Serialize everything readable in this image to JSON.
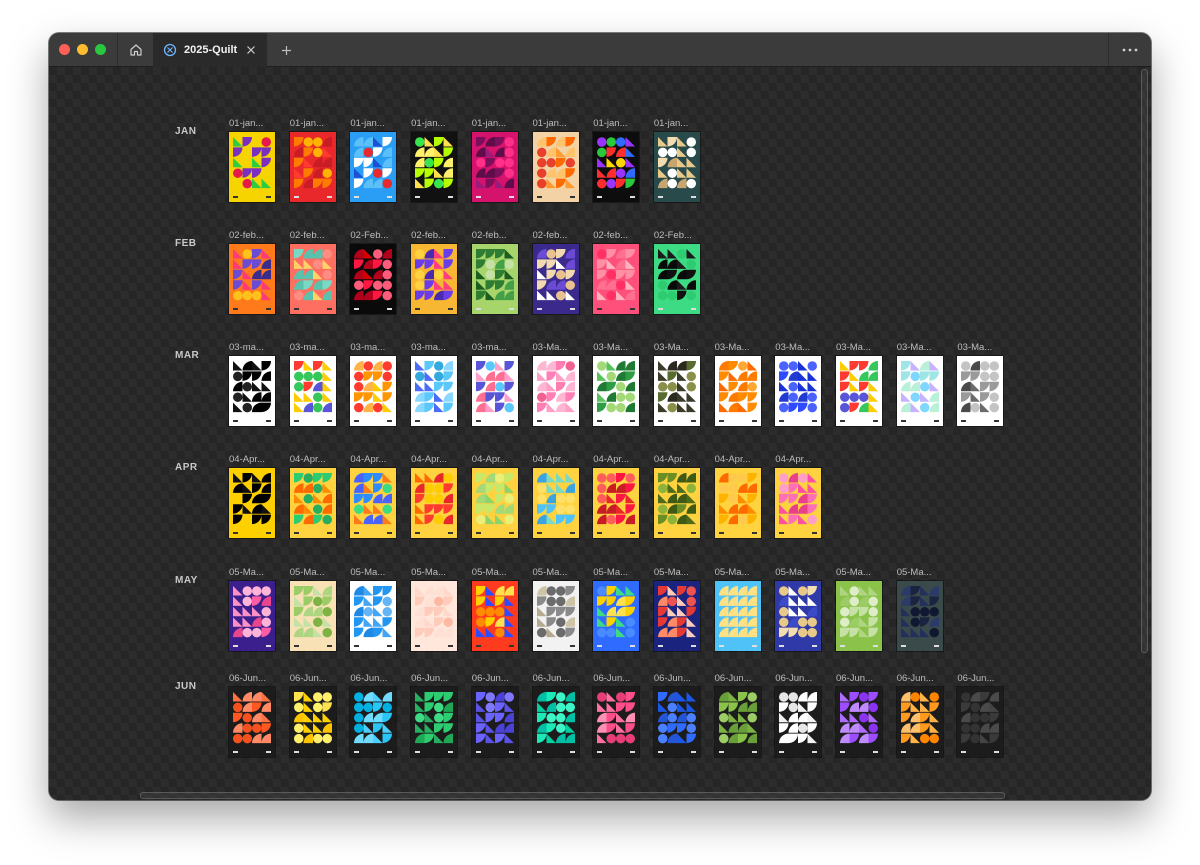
{
  "window": {
    "tab_title": "2025-Quilt",
    "icons": {
      "home": "home-icon",
      "tab": "figma-file-icon",
      "close": "close-icon",
      "new_tab": "plus-icon",
      "more": "more-horizontal-icon"
    }
  },
  "months": [
    {
      "label": "JAN",
      "thumbnails": [
        {
          "label": "01-jan...",
          "bg": "#f5d400",
          "colors": [
            "#7b2fbe",
            "#2ecc40",
            "#e6194b",
            "#f5d400"
          ]
        },
        {
          "label": "01-jan...",
          "bg": "#e8282a",
          "colors": [
            "#ff7b00",
            "#ff3b30",
            "#ffb300",
            "#c81d25"
          ]
        },
        {
          "label": "01-jan...",
          "bg": "#2a9df4",
          "colors": [
            "#ffffff",
            "#1a4fd6",
            "#e8282a",
            "#5bc0f8"
          ]
        },
        {
          "label": "01-jan...",
          "bg": "#111111",
          "colors": [
            "#b6ff00",
            "#ffe14d",
            "#38e54d",
            "#fff06a"
          ]
        },
        {
          "label": "01-jan...",
          "bg": "#d6136c",
          "colors": [
            "#7a0f5c",
            "#9b1b7a",
            "#ff2f8a",
            "#5e0c4a"
          ]
        },
        {
          "label": "01-jan...",
          "bg": "#f3d2a6",
          "colors": [
            "#ff6a00",
            "#ff9a2e",
            "#e8402a",
            "#ffc46b"
          ]
        },
        {
          "label": "01-jan...",
          "bg": "#0d0d0d",
          "colors": [
            "#ff2d2d",
            "#ffd600",
            "#29c93b",
            "#2f6bff",
            "#9b33ff"
          ]
        },
        {
          "label": "01-jan...",
          "bg": "#284a4a",
          "colors": [
            "#f3ddb0",
            "#e9c98a",
            "#ffffff",
            "#c7a56f"
          ]
        }
      ]
    },
    {
      "label": "FEB",
      "thumbnails": [
        {
          "label": "02-feb...",
          "bg": "#ff7a1a",
          "colors": [
            "#6b4bd6",
            "#ff3b77",
            "#ffc21a",
            "#3b2b8c"
          ]
        },
        {
          "label": "02-feb...",
          "bg": "#ff6f61",
          "colors": [
            "#7ad9c4",
            "#ffd166",
            "#ff8c82",
            "#59c2ad"
          ]
        },
        {
          "label": "02-Feb...",
          "bg": "#0a0a0a",
          "colors": [
            "#ff1744",
            "#d50000",
            "#ff5c7c",
            "#b3001b"
          ]
        },
        {
          "label": "02-feb...",
          "bg": "#f7b733",
          "colors": [
            "#6a3de8",
            "#ff3d7f",
            "#ffd23f",
            "#4a2bb0"
          ]
        },
        {
          "label": "02-feb...",
          "bg": "#a8d56b",
          "colors": [
            "#2e7d32",
            "#1b5e20",
            "#c5e1a5",
            "#43a047"
          ]
        },
        {
          "label": "02-feb...",
          "bg": "#3b2a8c",
          "colors": [
            "#f3d9b0",
            "#ffffff",
            "#e7c28e",
            "#6b4bd6"
          ]
        },
        {
          "label": "02-feb...",
          "bg": "#ff4f7b",
          "colors": [
            "#ff8fa3",
            "#ffb3c1",
            "#ff2e63",
            "#ff6f8f"
          ]
        },
        {
          "label": "02-Feb...",
          "bg": "#3ddc84",
          "colors": [
            "#111111",
            "#1b1b1b",
            "#2ecc71",
            "#0a0a0a"
          ]
        }
      ]
    },
    {
      "label": "MAR",
      "thumbnails": [
        {
          "label": "03-ma...",
          "bg": "#ffffff",
          "colors": [
            "#000000",
            "#111111",
            "#222222",
            "#000000"
          ]
        },
        {
          "label": "03-ma...",
          "bg": "#ffffff",
          "colors": [
            "#ff3b30",
            "#ffcc00",
            "#34c759",
            "#5856d6"
          ]
        },
        {
          "label": "03-ma...",
          "bg": "#ffffff",
          "colors": [
            "#ff9500",
            "#ffcc00",
            "#ff3b30",
            "#ffb347"
          ]
        },
        {
          "label": "03-ma...",
          "bg": "#ffffff",
          "colors": [
            "#5ac8fa",
            "#4a6cf7",
            "#34aadc",
            "#8ad8ff"
          ]
        },
        {
          "label": "03-ma...",
          "bg": "#ffffff",
          "colors": [
            "#5856d6",
            "#ff9ecb",
            "#5ac8fa",
            "#ff6f91"
          ]
        },
        {
          "label": "03-Ma...",
          "bg": "#ffffff",
          "colors": [
            "#ff7eb3",
            "#ff9fc5",
            "#f06292",
            "#ffb6d2"
          ]
        },
        {
          "label": "03-Ma...",
          "bg": "#ffffff",
          "colors": [
            "#2e9e44",
            "#58c35a",
            "#a3d977",
            "#1f7a33"
          ]
        },
        {
          "label": "03-Ma...",
          "bg": "#ffffff",
          "colors": [
            "#5a6b2f",
            "#3b3b2b",
            "#8a8f4a",
            "#2a2a1f"
          ]
        },
        {
          "label": "03-Ma...",
          "bg": "#ffffff",
          "colors": [
            "#ff8c00",
            "#ff6a00",
            "#ffa733",
            "#ff7b00"
          ]
        },
        {
          "label": "03-Ma...",
          "bg": "#ffffff",
          "colors": [
            "#2f4bff",
            "#1a33d6",
            "#4a63ff",
            "#213bd0"
          ]
        },
        {
          "label": "03-Ma...",
          "bg": "#ffffff",
          "colors": [
            "#ff3b30",
            "#ffcc00",
            "#5856d6",
            "#34c759"
          ]
        },
        {
          "label": "03-Ma...",
          "bg": "#ffffff",
          "colors": [
            "#9ee6e6",
            "#c6b3ff",
            "#7fd6ff",
            "#b8f0d8"
          ]
        },
        {
          "label": "03-Ma...",
          "bg": "#ffffff",
          "colors": [
            "#9a9a9a",
            "#6b6b6b",
            "#c4c4c4",
            "#4a4a4a"
          ]
        }
      ]
    },
    {
      "label": "APR",
      "thumbnails": [
        {
          "label": "04-Apr...",
          "bg": "#ffd000",
          "colors": [
            "#000000",
            "#111111",
            "#ffd000",
            "#000000"
          ]
        },
        {
          "label": "04-Apr...",
          "bg": "#ffd23f",
          "colors": [
            "#2ecc71",
            "#ff8c00",
            "#27ae60",
            "#ff6a00"
          ]
        },
        {
          "label": "04-Apr...",
          "bg": "#ffd23f",
          "colors": [
            "#2f8cff",
            "#ff7a1a",
            "#3ddc84",
            "#4a63ff"
          ]
        },
        {
          "label": "04-Apr...",
          "bg": "#ffd23f",
          "colors": [
            "#ff3b30",
            "#ff6a00",
            "#ffcc00",
            "#e8282a"
          ]
        },
        {
          "label": "04-Apr...",
          "bg": "#ffd23f",
          "colors": [
            "#c6e86b",
            "#8bd36b",
            "#e8f07a",
            "#a3d977"
          ]
        },
        {
          "label": "04-Apr...",
          "bg": "#ffd23f",
          "colors": [
            "#4fc3f7",
            "#7ad9c4",
            "#ffe066",
            "#3ba3e0"
          ]
        },
        {
          "label": "04-Apr...",
          "bg": "#ffd23f",
          "colors": [
            "#ff1744",
            "#e8282a",
            "#ff5c5c",
            "#c81d25"
          ]
        },
        {
          "label": "04-Apr...",
          "bg": "#ffd23f",
          "colors": [
            "#6b8e23",
            "#4e6b1a",
            "#8db33a",
            "#3f5a14"
          ]
        },
        {
          "label": "04-Apr...",
          "bg": "#ffd23f",
          "colors": [
            "#ffb300",
            "#ff8c00",
            "#ffc94d",
            "#ff6a00"
          ]
        },
        {
          "label": "04-Apr...",
          "bg": "#ffd23f",
          "colors": [
            "#ff6fb5",
            "#ff4fa0",
            "#ff9ecb",
            "#e83e8c"
          ]
        }
      ]
    },
    {
      "label": "MAY",
      "thumbnails": [
        {
          "label": "05-Ma...",
          "bg": "#3b1f8c",
          "colors": [
            "#ff5ca8",
            "#ff8fc7",
            "#ffb3d9",
            "#e8458c"
          ]
        },
        {
          "label": "05-Ma...",
          "bg": "#f7e1b5",
          "colors": [
            "#9ccc65",
            "#c5e1a5",
            "#7cb342",
            "#aed581"
          ]
        },
        {
          "label": "05-Ma...",
          "bg": "#ffffff",
          "colors": [
            "#2196f3",
            "#42a5f5",
            "#64b5f6",
            "#1e88e5"
          ]
        },
        {
          "label": "05-Ma...",
          "bg": "#ffe7dc",
          "colors": [
            "#ffccbc",
            "#ffd8c9",
            "#ffb9a3",
            "#ffe0d4"
          ]
        },
        {
          "label": "05-Ma...",
          "bg": "#ff3b1f",
          "colors": [
            "#ffd000",
            "#2f4bff",
            "#ff8c00",
            "#ffe14d"
          ]
        },
        {
          "label": "05-Ma...",
          "bg": "#f2f2f2",
          "colors": [
            "#8a8a8a",
            "#b5a98f",
            "#6b6b6b",
            "#cfc3a8"
          ]
        },
        {
          "label": "05-Ma...",
          "bg": "#2f6bff",
          "colors": [
            "#ffd000",
            "#3ddc84",
            "#4a8cff",
            "#ffe14d"
          ]
        },
        {
          "label": "05-Ma...",
          "bg": "#1a237e",
          "colors": [
            "#e53935",
            "#ffccbc",
            "#ef5350",
            "#ff8a65"
          ]
        },
        {
          "label": "05-Ma...",
          "bg": "#4fc3f7",
          "colors": [
            "#26c6da",
            "#ffd54f",
            "#0097a7",
            "#ffe082"
          ]
        },
        {
          "label": "05-Ma...",
          "bg": "#2f3aa8",
          "colors": [
            "#f3ddb0",
            "#ffffff",
            "#e9c98a",
            "#3b4bc8"
          ]
        },
        {
          "label": "05-Ma...",
          "bg": "#8bc34a",
          "colors": [
            "#c5e1a5",
            "#aed581",
            "#dcedc8",
            "#9ccc65"
          ]
        },
        {
          "label": "05-Ma...",
          "bg": "#3a4a4a",
          "colors": [
            "#1a2440",
            "#24305a",
            "#0f1830",
            "#2c3a6a"
          ]
        }
      ]
    },
    {
      "label": "JUN",
      "thumbnails": [
        {
          "label": "06-Jun...",
          "bg": "#1c1c1c",
          "colors": [
            "#ff5722",
            "#ff7043",
            "#f4511e",
            "#ff8a65"
          ]
        },
        {
          "label": "06-Jun...",
          "bg": "#1c1c1c",
          "colors": [
            "#ffe14d",
            "#ffd000",
            "#fff06a",
            "#ffc400"
          ]
        },
        {
          "label": "06-Jun...",
          "bg": "#1c1c1c",
          "colors": [
            "#29c5f6",
            "#4dd0ff",
            "#00b0e0",
            "#6fdcff"
          ]
        },
        {
          "label": "06-Jun...",
          "bg": "#1c1c1c",
          "colors": [
            "#2ecc71",
            "#27ae60",
            "#3ddc84",
            "#1fa855"
          ]
        },
        {
          "label": "06-Jun...",
          "bg": "#1c1c1c",
          "colors": [
            "#6b63ff",
            "#5a52e8",
            "#7f78ff",
            "#4a42d6"
          ]
        },
        {
          "label": "06-Jun...",
          "bg": "#1c1c1c",
          "colors": [
            "#1de9b6",
            "#00d1a0",
            "#3ef5c8",
            "#00bfa5"
          ]
        },
        {
          "label": "06-Jun...",
          "bg": "#1c1c1c",
          "colors": [
            "#ff4f8b",
            "#ff6fa0",
            "#e83e78",
            "#ff8fb3"
          ]
        },
        {
          "label": "06-Jun...",
          "bg": "#1c1c1c",
          "colors": [
            "#2f6bff",
            "#1a56e8",
            "#4a80ff",
            "#2455d6"
          ]
        },
        {
          "label": "06-Jun...",
          "bg": "#1c1c1c",
          "colors": [
            "#8bc34a",
            "#7cb342",
            "#9ccc65",
            "#689f38"
          ]
        },
        {
          "label": "06-Jun...",
          "bg": "#1c1c1c",
          "colors": [
            "#ffffff",
            "#f2f2f2",
            "#e6e6e6",
            "#ffffff"
          ]
        },
        {
          "label": "06-Jun...",
          "bg": "#1c1c1c",
          "colors": [
            "#9c4dff",
            "#b06bff",
            "#8a33f0",
            "#c08aff"
          ]
        },
        {
          "label": "06-Jun...",
          "bg": "#1c1c1c",
          "colors": [
            "#ff9a1f",
            "#ffb347",
            "#ff8400",
            "#ffc06b"
          ]
        },
        {
          "label": "06-Jun...",
          "bg": "#1c1c1c",
          "colors": [
            "#3a3a3a",
            "#444444",
            "#333333",
            "#4a4a4a"
          ]
        }
      ]
    }
  ]
}
